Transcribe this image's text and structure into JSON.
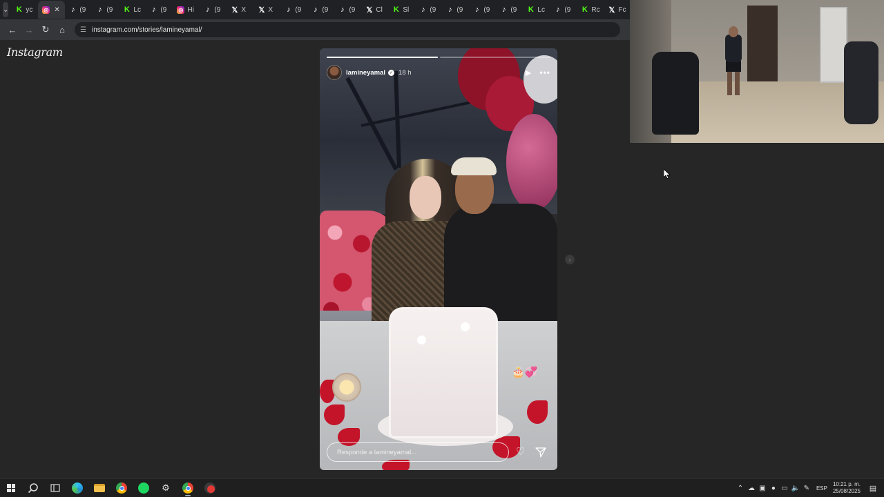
{
  "browser": {
    "tabs": [
      {
        "icon": "kick",
        "label": "yc",
        "active": false
      },
      {
        "icon": "instagram",
        "label": "",
        "active": true
      },
      {
        "icon": "tiktok",
        "label": "(9",
        "active": false
      },
      {
        "icon": "tiktok",
        "label": "(9",
        "active": false
      },
      {
        "icon": "kick",
        "label": "Lc",
        "active": false
      },
      {
        "icon": "tiktok",
        "label": "(9",
        "active": false
      },
      {
        "icon": "instagram",
        "label": "Hi",
        "active": false
      },
      {
        "icon": "tiktok",
        "label": "(9",
        "active": false
      },
      {
        "icon": "x",
        "label": "X",
        "active": false
      },
      {
        "icon": "x",
        "label": "X",
        "active": false
      },
      {
        "icon": "tiktok",
        "label": "(9",
        "active": false
      },
      {
        "icon": "tiktok",
        "label": "(9",
        "active": false
      },
      {
        "icon": "tiktok",
        "label": "(9",
        "active": false
      },
      {
        "icon": "x",
        "label": "Cl",
        "active": false
      },
      {
        "icon": "kick",
        "label": "Sl",
        "active": false
      },
      {
        "icon": "tiktok",
        "label": "(9",
        "active": false
      },
      {
        "icon": "tiktok",
        "label": "(9",
        "active": false
      },
      {
        "icon": "tiktok",
        "label": "(9",
        "active": false
      },
      {
        "icon": "tiktok",
        "label": "(9",
        "active": false
      },
      {
        "icon": "kick",
        "label": "Lc",
        "active": false
      },
      {
        "icon": "tiktok",
        "label": "(9",
        "active": false
      },
      {
        "icon": "kick",
        "label": "Rc",
        "active": false
      },
      {
        "icon": "x",
        "label": "Fc",
        "active": false
      }
    ],
    "url": "instagram.com/stories/lamineyamal/"
  },
  "instagram": {
    "logo": "Instagram",
    "story": {
      "username": "lamineyamal",
      "time": "18 h",
      "progress": [
        1.0,
        0.0
      ],
      "emoji": "🎂💞",
      "reply_placeholder": "Responde a lamineyamal..."
    }
  },
  "taskbar": {
    "apps": [
      "start",
      "search",
      "task-view",
      "edge",
      "file-explorer",
      "chrome",
      "spotify",
      "settings",
      "chrome-profile",
      "app-red"
    ],
    "language": "ESP",
    "time": "10:21 p. m.",
    "date": "25/08/2025"
  },
  "colors": {
    "page_bg": "#262626",
    "tabbar_bg": "#202124",
    "addressbar_bg": "#35363a",
    "taskbar_bg": "#1f1f1f",
    "kick_green": "#53fc18"
  }
}
